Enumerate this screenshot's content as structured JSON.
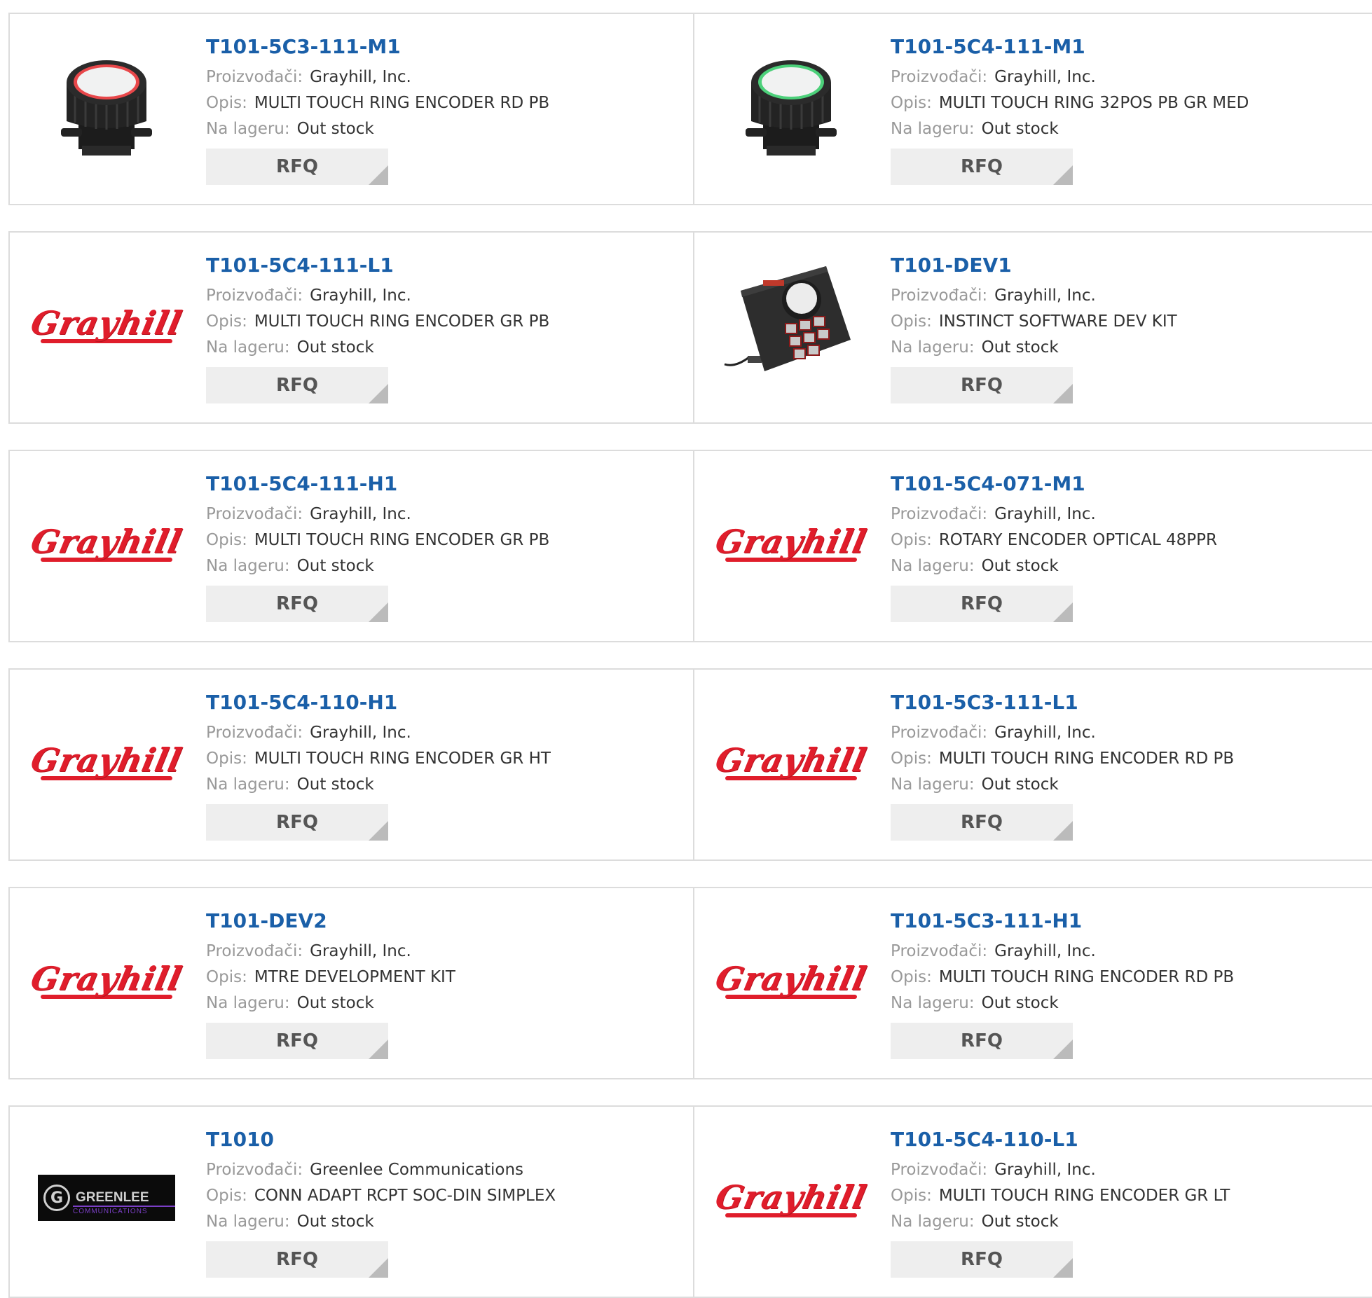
{
  "labels": {
    "manufacturer": "Proizvođači:",
    "description": "Opis:",
    "stock": "Na lageru:",
    "rfq": "RFQ"
  },
  "brand_logos": {
    "grayhill": "Grayhill",
    "greenlee": "GREENLEE",
    "greenlee_sub": "COMMUNICATIONS"
  },
  "products": [
    {
      "part": "T101-5C3-111-M1",
      "manufacturer": "Grayhill, Inc.",
      "description": "MULTI TOUCH RING ENCODER RD PB",
      "stock": "Out stock",
      "image": "encoder-red-ring"
    },
    {
      "part": "T101-5C4-111-M1",
      "manufacturer": "Grayhill, Inc.",
      "description": "MULTI TOUCH RING 32POS PB GR MED",
      "stock": "Out stock",
      "image": "encoder-green-ring"
    },
    {
      "part": "T101-5C4-111-L1",
      "manufacturer": "Grayhill, Inc.",
      "description": "MULTI TOUCH RING ENCODER GR PB",
      "stock": "Out stock",
      "image": "grayhill-logo"
    },
    {
      "part": "T101-DEV1",
      "manufacturer": "Grayhill, Inc.",
      "description": "INSTINCT SOFTWARE DEV KIT",
      "stock": "Out stock",
      "image": "dev-kit"
    },
    {
      "part": "T101-5C4-111-H1",
      "manufacturer": "Grayhill, Inc.",
      "description": "MULTI TOUCH RING ENCODER GR PB",
      "stock": "Out stock",
      "image": "grayhill-logo"
    },
    {
      "part": "T101-5C4-071-M1",
      "manufacturer": "Grayhill, Inc.",
      "description": "ROTARY ENCODER OPTICAL 48PPR",
      "stock": "Out stock",
      "image": "grayhill-logo"
    },
    {
      "part": "T101-5C4-110-H1",
      "manufacturer": "Grayhill, Inc.",
      "description": "MULTI TOUCH RING ENCODER GR HT",
      "stock": "Out stock",
      "image": "grayhill-logo"
    },
    {
      "part": "T101-5C3-111-L1",
      "manufacturer": "Grayhill, Inc.",
      "description": "MULTI TOUCH RING ENCODER RD PB",
      "stock": "Out stock",
      "image": "grayhill-logo"
    },
    {
      "part": "T101-DEV2",
      "manufacturer": "Grayhill, Inc.",
      "description": "MTRE DEVELOPMENT KIT",
      "stock": "Out stock",
      "image": "grayhill-logo"
    },
    {
      "part": "T101-5C3-111-H1",
      "manufacturer": "Grayhill, Inc.",
      "description": "MULTI TOUCH RING ENCODER RD PB",
      "stock": "Out stock",
      "image": "grayhill-logo"
    },
    {
      "part": "T1010",
      "manufacturer": "Greenlee Communications",
      "description": "CONN ADAPT RCPT SOC-DIN SIMPLEX",
      "stock": "Out stock",
      "image": "greenlee-logo"
    },
    {
      "part": "T101-5C4-110-L1",
      "manufacturer": "Grayhill, Inc.",
      "description": "MULTI TOUCH RING ENCODER GR LT",
      "stock": "Out stock",
      "image": "grayhill-logo"
    }
  ],
  "colors": {
    "part_link": "#1a5fa8",
    "grayhill_red": "#e01d2b",
    "ring_red": "#e8474a",
    "ring_green": "#4cd07a",
    "border": "#dcdcdc",
    "rfq_bg": "#eeeeee"
  }
}
